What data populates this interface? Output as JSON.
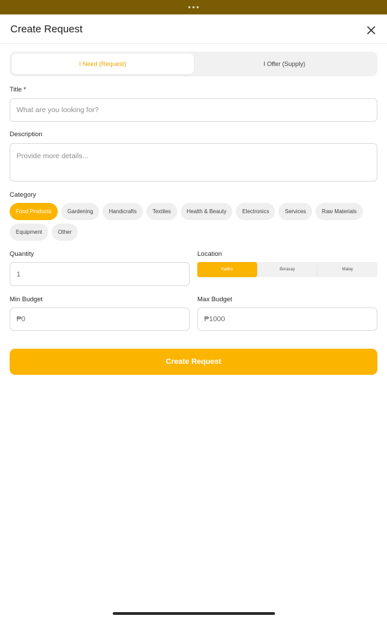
{
  "header": {
    "title": "Create Request"
  },
  "mode_tabs": [
    {
      "label": "I Need (Request)",
      "active": true
    },
    {
      "label": "I Offer (Supply)",
      "active": false
    }
  ],
  "form": {
    "title_label": "Title *",
    "title_placeholder": "What are you looking for?",
    "description_label": "Description",
    "description_placeholder": "Provide more details...",
    "category_label": "Category",
    "categories": [
      {
        "label": "Food Products",
        "active": true
      },
      {
        "label": "Gardening",
        "active": false
      },
      {
        "label": "Handicrafts",
        "active": false
      },
      {
        "label": "Textiles",
        "active": false
      },
      {
        "label": "Health & Beauty",
        "active": false
      },
      {
        "label": "Electronics",
        "active": false
      },
      {
        "label": "Services",
        "active": false
      },
      {
        "label": "Raw Materials",
        "active": false
      },
      {
        "label": "Equipment",
        "active": false
      },
      {
        "label": "Other",
        "active": false
      }
    ],
    "quantity_label": "Quantity",
    "quantity_value": "1",
    "location_label": "Location",
    "locations": [
      {
        "label": "Kalibo",
        "active": true
      },
      {
        "label": "Boracay",
        "active": false
      },
      {
        "label": "Malay",
        "active": false
      }
    ],
    "min_budget_label": "Min Budget",
    "min_budget_value": "₱0",
    "max_budget_label": "Max Budget",
    "max_budget_value": "₱1000",
    "submit_label": "Create Request"
  },
  "colors": {
    "accent": "#fbb400",
    "status_bar": "#7a5c05"
  },
  "icons": {
    "close": "close-icon"
  }
}
